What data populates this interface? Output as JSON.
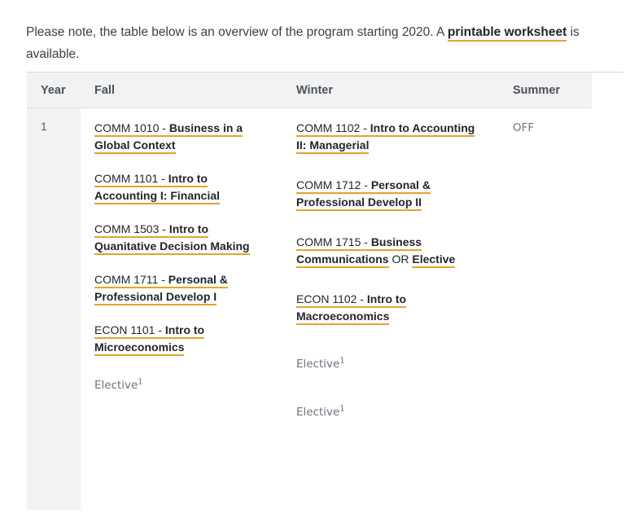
{
  "intro": {
    "text_before": "Please note, the table below is an overview of the program starting 2020. A ",
    "link_text": "printable worksheet",
    "text_after": " is available."
  },
  "table": {
    "columns": [
      "Year",
      "Fall",
      "Winter",
      "Summer"
    ],
    "rows": [
      {
        "year": "1",
        "fall": [
          {
            "kind": "course",
            "code": "COMM 1010",
            "separator": " - ",
            "title": "Business in a Global Context"
          },
          {
            "kind": "course",
            "code": "COMM 1101",
            "separator": " - ",
            "title": "Intro to Accounting I: Financial"
          },
          {
            "kind": "course",
            "code": "COMM 1503",
            "separator": " - ",
            "title": "Intro to Quanitative Decision Making"
          },
          {
            "kind": "course",
            "code": "COMM 1711",
            "separator": " - ",
            "title": "Personal & Professional Develop I"
          },
          {
            "kind": "course",
            "code": "ECON 1101",
            "separator": " - ",
            "title": "Intro to Microeconomics"
          },
          {
            "kind": "elective",
            "label": "Elective",
            "footnote": "1"
          }
        ],
        "winter": [
          {
            "kind": "course",
            "code": "COMM 1102",
            "separator": " - ",
            "title": "Intro to Accounting II: Managerial"
          },
          {
            "kind": "course",
            "code": "COMM 1712",
            "separator": " - ",
            "title": "Personal & Professional Develop II"
          },
          {
            "kind": "course_or",
            "code": "COMM 1715",
            "separator": " - ",
            "title": "Business Communications",
            "or_label": " OR ",
            "alt_title": "Elective"
          },
          {
            "kind": "course",
            "code": "ECON 1102",
            "separator": " - ",
            "title": "Intro to Macroeconomics"
          },
          {
            "kind": "elective",
            "label": "Elective",
            "footnote": "1"
          },
          {
            "kind": "elective",
            "label": "Elective",
            "footnote": "1"
          }
        ],
        "summer": [
          {
            "kind": "off",
            "label": "OFF"
          }
        ]
      }
    ]
  },
  "colors": {
    "link_underline": "#e3a52b",
    "link_text": "#22252c",
    "header_bg": "#f2f2f2",
    "muted_text": "#6b7280"
  }
}
